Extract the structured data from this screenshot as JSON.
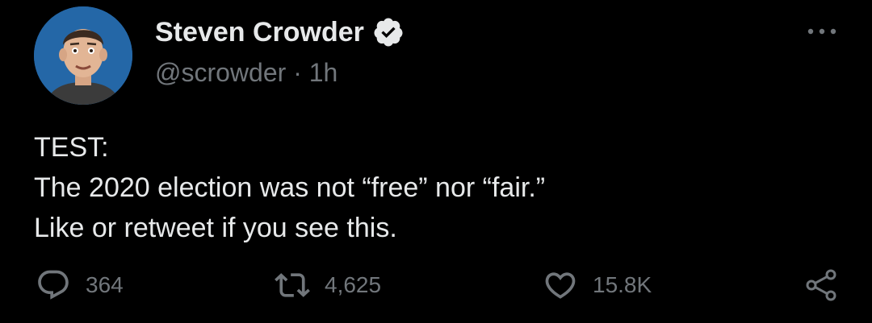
{
  "author": {
    "name": "Steven Crowder",
    "handle": "@scrowder",
    "separator": "·",
    "time": "1h",
    "verified": true,
    "avatar": "avatar-photo"
  },
  "tweet": {
    "lines": [
      "TEST:",
      "The 2020 election was not “free” nor “fair.”",
      "Like or retweet if you see this."
    ]
  },
  "actions": {
    "reply": {
      "icon": "reply-icon",
      "count": "364"
    },
    "retweet": {
      "icon": "retweet-icon",
      "count": "4,625"
    },
    "like": {
      "icon": "heart-icon",
      "count": "15.8K"
    },
    "share": {
      "icon": "share-icon"
    }
  },
  "menu": {
    "icon": "more-options-icon"
  },
  "colors": {
    "background": "#000000",
    "primary_text": "#e7e9ea",
    "secondary_text": "#71767b",
    "avatar_bg": "#1f5f9e"
  }
}
